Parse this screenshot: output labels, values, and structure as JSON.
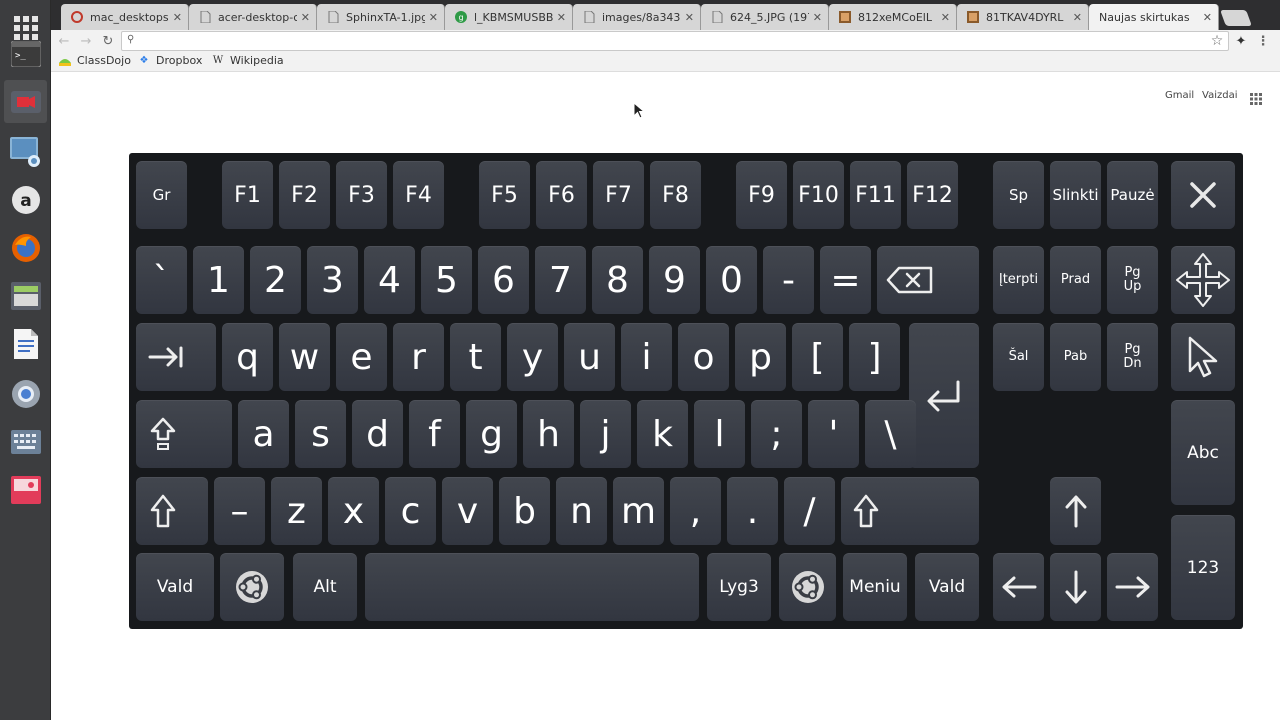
{
  "launcher": {
    "items": [
      {
        "icon": "terminal-icon"
      },
      {
        "icon": "video-camera-icon"
      },
      {
        "icon": "screenshot-icon"
      },
      {
        "icon": "amazon-icon"
      },
      {
        "icon": "firefox-icon"
      },
      {
        "icon": "files-icon"
      },
      {
        "icon": "document-icon"
      },
      {
        "icon": "chrome-icon"
      },
      {
        "icon": "keyboard-icon"
      },
      {
        "icon": "app-icon"
      }
    ]
  },
  "browser": {
    "tabs": [
      {
        "title": "mac_desktops",
        "icon": "red-favicon",
        "color": "#c0392b"
      },
      {
        "title": "acer-desktop-c",
        "icon": "page-favicon",
        "color": "#777"
      },
      {
        "title": "SphinxTA-1.jpg",
        "icon": "page-favicon",
        "color": "#777"
      },
      {
        "title": "l_KBMSMUSBB",
        "icon": "green-favicon",
        "color": "#2e9a46"
      },
      {
        "title": "images/8a343",
        "icon": "page-favicon",
        "color": "#777"
      },
      {
        "title": "624_5.JPG (197",
        "icon": "page-favicon",
        "color": "#777"
      },
      {
        "title": "812xeMCoElL",
        "icon": "amazon-favicon",
        "color": "#8a5a2b"
      },
      {
        "title": "81TKAV4DYRL",
        "icon": "amazon-favicon",
        "color": "#8a5a2b"
      },
      {
        "title": "Naujas skirtukas",
        "icon": "none",
        "color": "#777"
      }
    ],
    "omnibox_value": "",
    "bookmarks": [
      {
        "label": "ClassDojo",
        "icon": "classdojo-icon"
      },
      {
        "label": "Dropbox",
        "icon": "dropbox-icon"
      },
      {
        "label": "Wikipedia",
        "icon": "wikipedia-icon"
      }
    ],
    "newtab": {
      "gmail": "Gmail",
      "images": "Vaizdai"
    }
  },
  "keyboard": {
    "fn_row": [
      "Gr",
      "F1",
      "F2",
      "F3",
      "F4",
      "F5",
      "F6",
      "F7",
      "F8",
      "F9",
      "F10",
      "F11",
      "F12",
      "Sp",
      "Slinkti",
      "Pauzė"
    ],
    "number_row": [
      "`",
      "1",
      "2",
      "3",
      "4",
      "5",
      "6",
      "7",
      "8",
      "9",
      "0",
      "-",
      "="
    ],
    "top_row": [
      "q",
      "w",
      "e",
      "r",
      "t",
      "y",
      "u",
      "i",
      "o",
      "p",
      "[",
      "]"
    ],
    "home_row": [
      "a",
      "s",
      "d",
      "f",
      "g",
      "h",
      "j",
      "k",
      "l",
      ";",
      "'",
      "\\"
    ],
    "bottom_row": [
      "–",
      "z",
      "x",
      "c",
      "v",
      "b",
      "n",
      "m",
      ",",
      ".",
      "/"
    ],
    "modifiers": {
      "ctrl_left": "Vald",
      "alt": "Alt",
      "level3": "Lyg3",
      "menu": "Meniu",
      "ctrl_right": "Vald"
    },
    "nav": {
      "insert": "Įterpti",
      "home": "Prad",
      "page_up": "Pg\nUp",
      "delete": "Šal",
      "end": "Pab",
      "page_down": "Pg\nDn"
    },
    "side": {
      "abc": "Abc",
      "num": "123"
    }
  }
}
